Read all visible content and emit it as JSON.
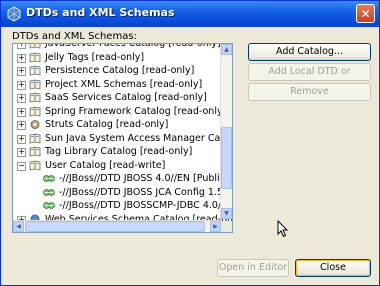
{
  "window": {
    "title": "DTDs and XML Schemas",
    "close_glyph": "✕"
  },
  "tree_label": "DTDs and XML Schemas:",
  "tree_items": [
    {
      "label": "JavaServer Faces Catalog [read-only]",
      "expander": "+",
      "icon": "catalog-book-icon"
    },
    {
      "label": "Jelly Tags [read-only]",
      "expander": "+",
      "icon": "catalog-book-icon"
    },
    {
      "label": "Persistence Catalog [read-only]",
      "expander": "+",
      "icon": "catalog-book-icon"
    },
    {
      "label": "Project XML Schemas [read-only]",
      "expander": "+",
      "icon": "catalog-book-icon"
    },
    {
      "label": "SaaS Services Catalog [read-only]",
      "expander": "+",
      "icon": "catalog-book-icon"
    },
    {
      "label": "Spring Framework Catalog [read-only]",
      "expander": "+",
      "icon": "catalog-book-icon"
    },
    {
      "label": "Struts Catalog [read-only]",
      "expander": "+",
      "icon": "catalog-gear-icon"
    },
    {
      "label": "Sun Java System Access Manager Catalog [read",
      "expander": "+",
      "icon": "catalog-book-icon"
    },
    {
      "label": "Tag Library Catalog [read-only]",
      "expander": "+",
      "icon": "catalog-book-icon"
    },
    {
      "label": "User Catalog [read-write]",
      "expander": "−",
      "icon": "catalog-book-icon"
    },
    {
      "label": "-//JBoss//DTD JBOSS 4.0//EN [Public ID]",
      "expander": "",
      "icon": "dtd-entry-icon",
      "child": true
    },
    {
      "label": "-//JBoss//DTD JBOSS JCA Config 1.5//EN [P",
      "expander": "",
      "icon": "dtd-entry-icon",
      "child": true
    },
    {
      "label": "-//JBoss//DTD JBOSSCMP-JDBC 4.0//EN [P",
      "expander": "",
      "icon": "dtd-entry-icon",
      "child": true
    },
    {
      "label": "Web Services Schema Catalog [read-only]",
      "expander": "+",
      "icon": "web-services-icon"
    }
  ],
  "buttons": {
    "add_catalog": "Add Catalog...",
    "add_local": "Add Local DTD or Schema...",
    "remove": "Remove",
    "open_in_editor": "Open in Editor",
    "close": "Close"
  },
  "colors": {
    "title_bar": "#0a4ad8",
    "dialog_bg": "#ece9d8",
    "tree_border": "#7f9db9"
  }
}
